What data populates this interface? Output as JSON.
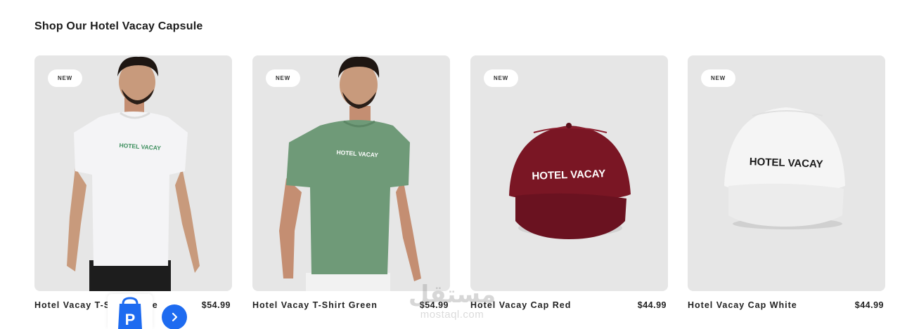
{
  "section": {
    "title": "Shop Our Hotel Vacay Capsule"
  },
  "products": [
    {
      "badge": "NEW",
      "name": "Hotel Vacay T-Shirt White",
      "price": "$54.99",
      "print": "HOTEL VACAY",
      "image_icon": "white-tshirt-model-image"
    },
    {
      "badge": "NEW",
      "name": "Hotel Vacay T-Shirt Green",
      "price": "$54.99",
      "print": "HOTEL VACAY",
      "image_icon": "green-tshirt-model-image"
    },
    {
      "badge": "NEW",
      "name": "Hotel Vacay Cap Red",
      "price": "$44.99",
      "print": "HOTEL VACAY",
      "image_icon": "red-cap-image"
    },
    {
      "badge": "NEW",
      "name": "Hotel Vacay Cap White",
      "price": "$44.99",
      "print": "HOTEL VACAY",
      "image_icon": "white-cap-image"
    }
  ],
  "colors": {
    "card_bg": "#e6e6e6",
    "tshirt_white": "#f4f4f6",
    "tshirt_green": "#6f9a78",
    "cap_red": "#7a1624",
    "cap_white": "#f5f5f5",
    "accent_blue": "#1e6bf0"
  },
  "overlay": {
    "watermark": "مستقل",
    "watermark_url": "mostaql.com",
    "next_icon": "chevron-right-icon",
    "shop_icon": "shopping-bag-icon"
  }
}
